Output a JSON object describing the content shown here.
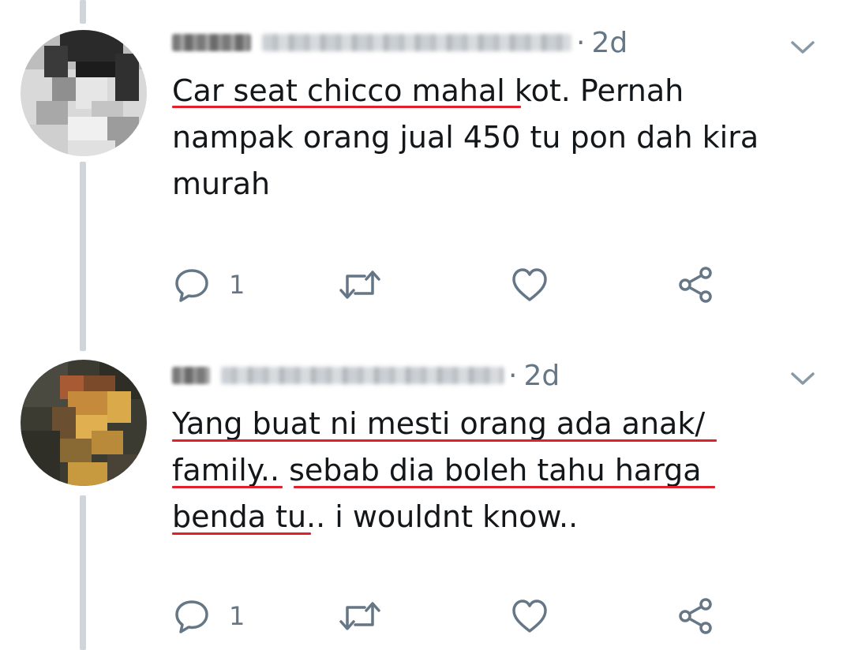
{
  "tweets": [
    {
      "time": "2d",
      "text": "Car seat chicco mahal kot. Pernah\nnampak orang jual 450 tu pon dah kira\nmurah",
      "reply_count": "1",
      "avatar_icon": "avatar-pixelated",
      "underline_color": "#e0202a"
    },
    {
      "time": "2d",
      "text": "Yang buat ni mesti orang ada anak/\nfamily.. sebab dia boleh tahu harga\nbenda tu.. i wouldnt know..",
      "reply_count": "1",
      "avatar_icon": "avatar-pixelated",
      "underline_color": "#e0202a"
    }
  ],
  "action_icons": [
    "reply-icon",
    "retweet-icon",
    "like-icon",
    "share-icon"
  ],
  "colors": {
    "text": "#14171a",
    "muted": "#657786",
    "thread_line": "#cfd5da",
    "underline": "#e0202a"
  }
}
